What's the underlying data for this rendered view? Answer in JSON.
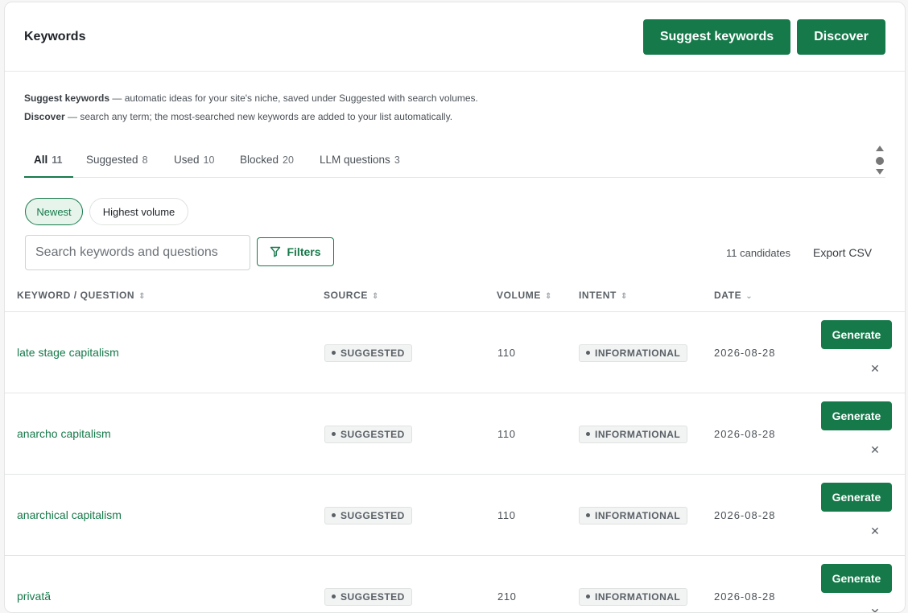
{
  "header": {
    "title": "Keywords",
    "suggest_label": "Suggest keywords",
    "discover_label": "Discover"
  },
  "help": {
    "suggest_term": "Suggest keywords",
    "suggest_text": " — automatic ideas for your site's niche, saved under Suggested with search volumes.",
    "discover_term": "Discover",
    "discover_text": " — search any term; the most-searched new keywords are added to your list automatically."
  },
  "tabs": [
    {
      "label": "All",
      "count": "11",
      "active": true
    },
    {
      "label": "Suggested",
      "count": "8"
    },
    {
      "label": "Used",
      "count": "10"
    },
    {
      "label": "Blocked",
      "count": "20"
    },
    {
      "label": "LLM questions",
      "count": "3"
    }
  ],
  "sort_pills": {
    "newest": "Newest",
    "highest_volume": "Highest volume",
    "active": "newest"
  },
  "search": {
    "placeholder": "Search keywords and questions",
    "value": ""
  },
  "filters_label": "Filters",
  "candidates_text": "11 candidates",
  "export_label": "Export CSV",
  "table": {
    "columns": {
      "keyword": "KEYWORD / QUESTION",
      "source": "SOURCE",
      "volume": "VOLUME",
      "intent": "INTENT",
      "date": "DATE"
    },
    "rows": [
      {
        "keyword": "late stage capitalism",
        "source": "SUGGESTED",
        "volume": "110",
        "intent": "INFORMATIONAL",
        "date": "2026-08-28",
        "action": "Generate"
      },
      {
        "keyword": "anarcho capitalism",
        "source": "SUGGESTED",
        "volume": "110",
        "intent": "INFORMATIONAL",
        "date": "2026-08-28",
        "action": "Generate"
      },
      {
        "keyword": "anarchical capitalism",
        "source": "SUGGESTED",
        "volume": "110",
        "intent": "INFORMATIONAL",
        "date": "2026-08-28",
        "action": "Generate"
      },
      {
        "keyword": "privată",
        "source": "SUGGESTED",
        "volume": "210",
        "intent": "INFORMATIONAL",
        "date": "2026-08-28",
        "action": "Generate"
      }
    ]
  },
  "icons": {
    "filter": "funnel-icon",
    "dismiss": "close-icon",
    "sort": "sort-icon"
  },
  "colors": {
    "accent": "#16794a",
    "accent_light": "#e6f4ec",
    "badge_bg": "#f2f3f3"
  }
}
